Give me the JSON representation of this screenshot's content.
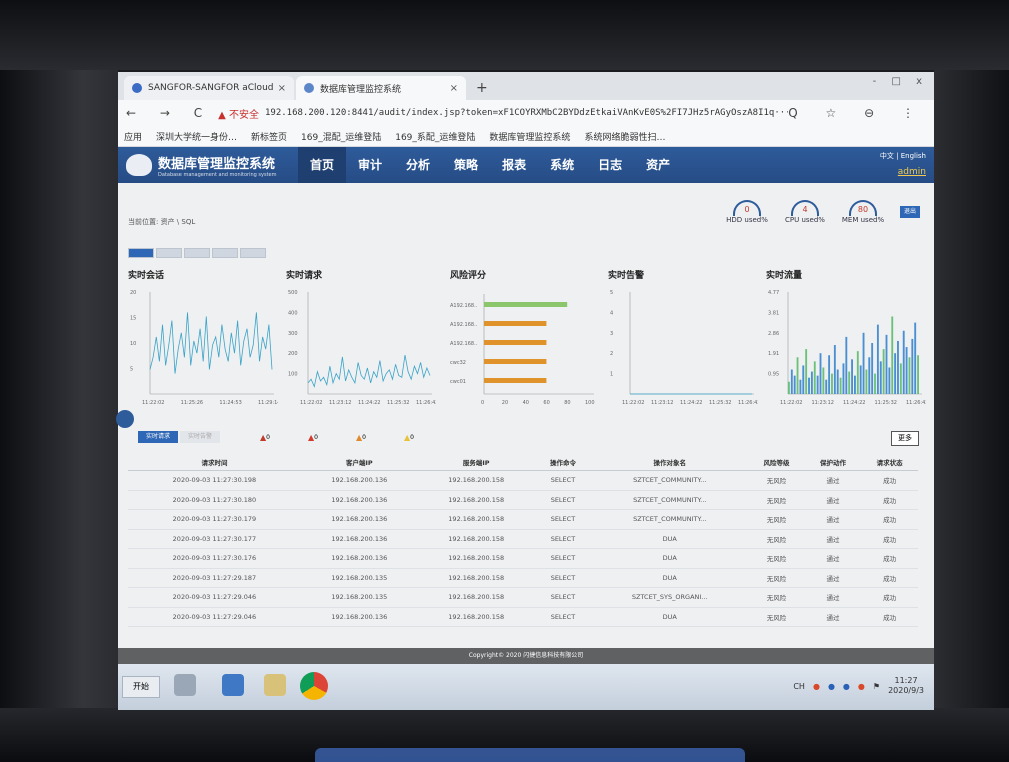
{
  "browser": {
    "tabs": [
      {
        "title": "SANGFOR-SANGFOR aCloud"
      },
      {
        "title": "数据库管理监控系统"
      }
    ],
    "window_controls": "- □ x",
    "address": {
      "nav": "← → C",
      "security": "▲ 不安全",
      "url": "192.168.200.120:8441/audit/index.jsp?token=xF1COYRXMbC2BYDdzEtkaiVAnKvE0S%2FI7JHz5rAGyOszA8I1q···",
      "right": "Q ☆ ⊖ ⋮"
    },
    "bookmarks": [
      "应用",
      "深圳大学统一身份…",
      "新标签页",
      "169_混配_运维登陆",
      "169_系配_运维登陆",
      "数据库管理监控系统",
      "系统网络脆弱性扫…"
    ]
  },
  "app": {
    "title": "数据库管理监控系统",
    "subtitle": "Database management and monitoring system",
    "menu": [
      "首页",
      "审计",
      "分析",
      "策略",
      "报表",
      "系统",
      "日志",
      "资产"
    ],
    "lang": "中文 | English",
    "user": "admin",
    "breadcrumb": "当前位置: 资产 \\ SQL",
    "gauges": [
      {
        "value": "0",
        "label": "HDD used%"
      },
      {
        "value": "4",
        "label": "CPU used%"
      },
      {
        "value": "80",
        "label": "MEM used%"
      }
    ],
    "exit_label": "退出",
    "panels": {
      "sessions": {
        "title": "实时会话",
        "yticks": [
          "20",
          "15",
          "10",
          "5"
        ],
        "xticks": [
          "11:22:02",
          "11:25:26",
          "11:24:53",
          "11:29:14"
        ]
      },
      "requests": {
        "title": "实时请求",
        "yticks": [
          "500",
          "400",
          "300",
          "200",
          "100"
        ],
        "xticks": [
          "11:22:02",
          "11:23:12",
          "11:24:22",
          "11:25:32",
          "11:26:42"
        ]
      },
      "risk": {
        "title": "风险评分",
        "labels": [
          "A192.168..",
          "A192.168..",
          "A192.168..",
          "cwc32",
          "cwc01"
        ],
        "xticks": [
          "0",
          "20",
          "40",
          "60",
          "80",
          "100"
        ]
      },
      "alerts": {
        "title": "实时告警",
        "yticks": [
          "5",
          "4",
          "3",
          "2",
          "1"
        ],
        "xticks": [
          "11:22:02",
          "11:23:12",
          "11:24:22",
          "11:25:32",
          "11:26:42"
        ]
      },
      "traffic": {
        "title": "实时流量",
        "yticks": [
          "4.77",
          "3.81",
          "2.86",
          "1.91",
          "0.95"
        ],
        "xticks": [
          "11:22:02",
          "11:23:12",
          "11:24:22",
          "11:25:32",
          "11:26:42"
        ]
      }
    },
    "alert_tabs": [
      "实时请求",
      "实时告警"
    ],
    "alert_counts": [
      "0",
      "0",
      "0",
      "0"
    ],
    "more_label": "更多",
    "table": {
      "headers": [
        "请求时间",
        "客户端IP",
        "服务端IP",
        "操作命令",
        "操作对象名",
        "风险等级",
        "保护动作",
        "请求状态"
      ],
      "rows": [
        [
          "2020-09-03 11:27:30.198",
          "192.168.200.136",
          "192.168.200.158",
          "SELECT",
          "SZTCET_COMMUNITY...",
          "无风险",
          "通过",
          "成功"
        ],
        [
          "2020-09-03 11:27:30.180",
          "192.168.200.136",
          "192.168.200.158",
          "SELECT",
          "SZTCET_COMMUNITY...",
          "无风险",
          "通过",
          "成功"
        ],
        [
          "2020-09-03 11:27:30.179",
          "192.168.200.136",
          "192.168.200.158",
          "SELECT",
          "SZTCET_COMMUNITY...",
          "无风险",
          "通过",
          "成功"
        ],
        [
          "2020-09-03 11:27:30.177",
          "192.168.200.136",
          "192.168.200.158",
          "SELECT",
          "DUA",
          "无风险",
          "通过",
          "成功"
        ],
        [
          "2020-09-03 11:27:30.176",
          "192.168.200.136",
          "192.168.200.158",
          "SELECT",
          "DUA",
          "无风险",
          "通过",
          "成功"
        ],
        [
          "2020-09-03 11:27:29.187",
          "192.168.200.135",
          "192.168.200.158",
          "SELECT",
          "DUA",
          "无风险",
          "通过",
          "成功"
        ],
        [
          "2020-09-03 11:27:29.046",
          "192.168.200.135",
          "192.168.200.158",
          "SELECT",
          "SZTCET_SYS_ORGANI...",
          "无风险",
          "通过",
          "成功"
        ],
        [
          "2020-09-03 11:27:29.046",
          "192.168.200.136",
          "192.168.200.158",
          "SELECT",
          "DUA",
          "无风险",
          "通过",
          "成功"
        ]
      ]
    },
    "footer": "Copyright© 2020 闪捷信息科技有限公司"
  },
  "taskbar": {
    "start": "开始",
    "tray": "CH",
    "time": "11:27",
    "date": "2020/9/3"
  },
  "colors": {
    "accent": "#2e5b9a",
    "risk_green": "#8cc66a",
    "risk_orange": "#e0922b",
    "series": "#3aa3c8"
  },
  "chart_data": [
    {
      "type": "line",
      "title": "实时会话",
      "ylim": [
        0,
        25
      ],
      "values": [
        6,
        9,
        14,
        8,
        17,
        7,
        12,
        18,
        5,
        11,
        15,
        9,
        20,
        7,
        13,
        10,
        16,
        8,
        19,
        6,
        12,
        14,
        9,
        17,
        11,
        8,
        15,
        10,
        18,
        7,
        13,
        16,
        9,
        12,
        20,
        8,
        14,
        11,
        17,
        6
      ]
    },
    {
      "type": "line",
      "title": "实时请求",
      "ylim": [
        0,
        550
      ],
      "values": [
        60,
        80,
        40,
        120,
        70,
        90,
        50,
        150,
        60,
        110,
        80,
        200,
        70,
        130,
        90,
        60,
        170,
        100,
        80,
        140,
        60,
        120,
        90,
        180,
        70,
        110,
        130,
        80,
        160,
        100,
        90,
        210,
        120,
        80,
        150,
        110,
        170,
        90,
        140,
        100
      ]
    },
    {
      "type": "bar",
      "title": "风险评分",
      "categories": [
        "A192.168..",
        "A192.168..",
        "A192.168..",
        "cwc32",
        "cwc01"
      ],
      "values": [
        80,
        60,
        60,
        60,
        60
      ],
      "xlim": [
        0,
        100
      ]
    },
    {
      "type": "line",
      "title": "实时告警",
      "ylim": [
        0,
        5
      ],
      "values": [
        0,
        0,
        0,
        0,
        0
      ]
    },
    {
      "type": "bar",
      "title": "实时流量",
      "ylim": [
        0,
        5
      ],
      "values": [
        0.6,
        1.2,
        0.9,
        1.8,
        0.7,
        1.4,
        2.2,
        0.8,
        1.1,
        1.6,
        0.9,
        2.0,
        1.3,
        0.7,
        1.9,
        1.0,
        2.4,
        1.2,
        0.8,
        1.5,
        2.8,
        1.1,
        1.7,
        0.9,
        2.1,
        1.4,
        3.0,
        1.2,
        1.8,
        2.5,
        1.0,
        3.4,
        1.6,
        2.2,
        2.9,
        1.3,
        3.8,
        2.0,
        2.6,
        1.5,
        3.1,
        2.3,
        1.8,
        2.7,
        3.5,
        1.9
      ]
    }
  ]
}
